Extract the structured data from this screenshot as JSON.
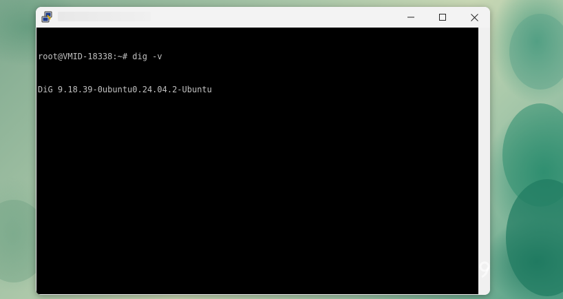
{
  "desktop": {
    "wallpaper": "green-leaves"
  },
  "window": {
    "title": "",
    "app_icon": "putty-icon",
    "controls": {
      "minimize_icon": "minimize-icon",
      "maximize_icon": "maximize-icon",
      "close_icon": "close-icon"
    }
  },
  "terminal": {
    "lines": [
      "root@VMID-18338:~# dig -v",
      "DiG 9.18.39-0ubuntu0.24.04.2-Ubuntu"
    ],
    "background": "#000000",
    "foreground": "#c0c0c0"
  }
}
